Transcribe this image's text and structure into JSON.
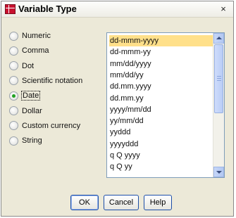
{
  "window": {
    "title": "Variable Type",
    "close_label": "×"
  },
  "types": [
    {
      "label": "Numeric",
      "checked": false
    },
    {
      "label": "Comma",
      "checked": false
    },
    {
      "label": "Dot",
      "checked": false
    },
    {
      "label": "Scientific notation",
      "checked": false
    },
    {
      "label": "Date",
      "checked": true
    },
    {
      "label": "Dollar",
      "checked": false
    },
    {
      "label": "Custom currency",
      "checked": false
    },
    {
      "label": "String",
      "checked": false
    }
  ],
  "formats": {
    "items": [
      "dd-mmm-yyyy",
      "dd-mmm-yy",
      "mm/dd/yyyy",
      "mm/dd/yy",
      "dd.mm.yyyy",
      "dd.mm.yy",
      "yyyy/mm/dd",
      "yy/mm/dd",
      "yyddd",
      "yyyyddd",
      "q Q yyyy",
      "q Q yy"
    ],
    "selected_index": 0
  },
  "buttons": {
    "ok": "OK",
    "cancel": "Cancel",
    "help": "Help"
  },
  "colors": {
    "selection": "#ffe08a",
    "button_border": "#1c4ea8",
    "checked_dot": "#21a121"
  }
}
